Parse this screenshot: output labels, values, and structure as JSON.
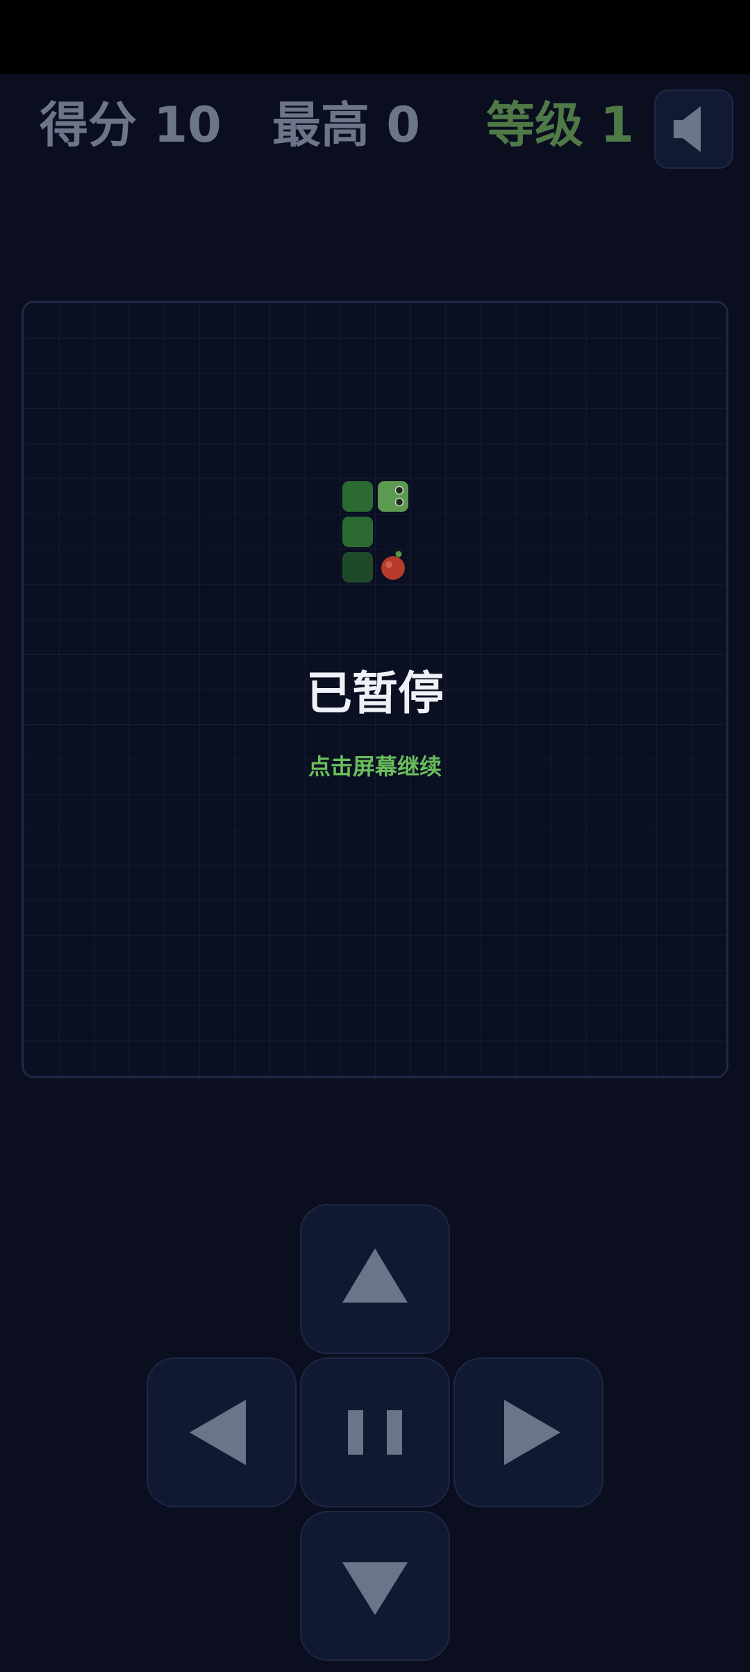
{
  "hud": {
    "score_label": "得分 10",
    "best_label": "最高 0",
    "level_label": "等级 1",
    "sound_icon": "speaker-icon"
  },
  "game": {
    "state": "paused",
    "pause_title": "已暂停",
    "pause_hint": "点击屏幕继续",
    "snake": {
      "head": [
        1,
        0
      ],
      "body": [
        [
          0,
          0
        ],
        [
          0,
          1
        ],
        [
          0,
          2
        ]
      ],
      "direction": "right"
    },
    "food": [
      1,
      2
    ]
  },
  "controls": {
    "up_icon": "triangle-up-icon",
    "left_icon": "triangle-left-icon",
    "pause_icon": "pause-icon",
    "right_icon": "triangle-right-icon",
    "down_icon": "triangle-down-icon"
  },
  "colors": {
    "background": "#0a0e1f",
    "snake_head": "#5b9a4f",
    "snake_body": "#2b6b33",
    "snake_tail": "#1f4a2a",
    "food": "#b83a2c",
    "hint": "#6abf5b",
    "level": "#4f7a48"
  }
}
